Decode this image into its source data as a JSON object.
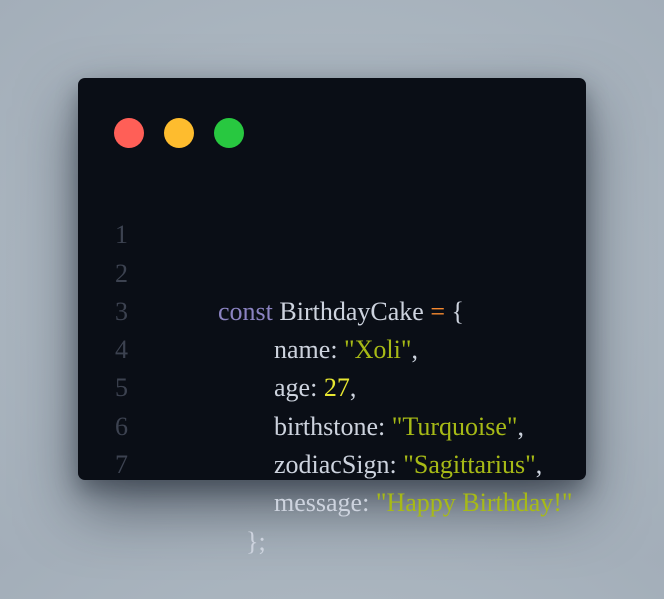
{
  "colors": {
    "window_bg": "#0a0e16",
    "dot_red": "#ff5f57",
    "dot_yellow": "#febc2e",
    "dot_green": "#28c840",
    "line_number": "#3c4250",
    "keyword": "#8b83c2",
    "identifier": "#cdd3de",
    "operator": "#f7892f",
    "string": "#a7ba16",
    "number": "#e7e631",
    "punctuation": "#cdd3de"
  },
  "window": {
    "controls": [
      {
        "name": "close",
        "color": "#ff5f57"
      },
      {
        "name": "minimize",
        "color": "#febc2e"
      },
      {
        "name": "maximize",
        "color": "#28c840"
      }
    ]
  },
  "code": {
    "lines": [
      {
        "number": "1",
        "indent": 0,
        "tokens": [
          {
            "text": "const",
            "type": "keyword"
          },
          {
            "text": " ",
            "type": "space"
          },
          {
            "text": "BirthdayCake",
            "type": "identifier"
          },
          {
            "text": " ",
            "type": "space"
          },
          {
            "text": "=",
            "type": "operator"
          },
          {
            "text": " ",
            "type": "space"
          },
          {
            "text": "{",
            "type": "punctuation"
          }
        ]
      },
      {
        "number": "2",
        "indent": 1,
        "tokens": [
          {
            "text": "name",
            "type": "identifier"
          },
          {
            "text": ": ",
            "type": "punctuation"
          },
          {
            "text": "\"Xoli\"",
            "type": "string"
          },
          {
            "text": ",",
            "type": "punctuation"
          }
        ]
      },
      {
        "number": "3",
        "indent": 1,
        "tokens": [
          {
            "text": "age",
            "type": "identifier"
          },
          {
            "text": ": ",
            "type": "punctuation"
          },
          {
            "text": "27",
            "type": "number"
          },
          {
            "text": ",",
            "type": "punctuation"
          }
        ]
      },
      {
        "number": "4",
        "indent": 1,
        "tokens": [
          {
            "text": "birthstone",
            "type": "identifier"
          },
          {
            "text": ": ",
            "type": "punctuation"
          },
          {
            "text": "\"Turquoise\"",
            "type": "string"
          },
          {
            "text": ",",
            "type": "punctuation"
          }
        ]
      },
      {
        "number": "5",
        "indent": 1,
        "tokens": [
          {
            "text": "zodiacSign",
            "type": "identifier"
          },
          {
            "text": ": ",
            "type": "punctuation"
          },
          {
            "text": "\"Sagittarius\"",
            "type": "string"
          },
          {
            "text": ",",
            "type": "punctuation"
          }
        ]
      },
      {
        "number": "6",
        "indent": 1,
        "tokens": [
          {
            "text": "message",
            "type": "identifier"
          },
          {
            "text": ": ",
            "type": "punctuation"
          },
          {
            "text": "\"Happy Birthday!\"",
            "type": "string"
          }
        ]
      },
      {
        "number": "7",
        "indent": -1,
        "tokens": [
          {
            "text": "};",
            "type": "punctuation"
          }
        ]
      }
    ]
  }
}
